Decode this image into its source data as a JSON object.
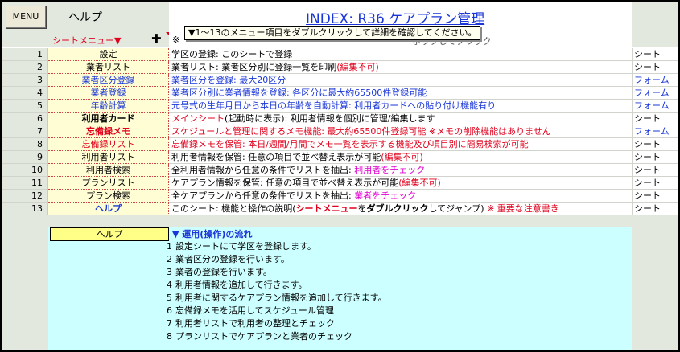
{
  "header": {
    "menu_button": "MENU",
    "help_label": "ヘルプ",
    "title": "INDEX: R36 ケアプラン管理",
    "sheet_menu": "シートメニュー▼",
    "tooltip": "▼1〜13のメニュー項目をダブルクリックして詳細を確認してください。",
    "note_prefix": "※",
    "note_suffix": "ホックしてクリック"
  },
  "menu_rows": [
    {
      "num": "1",
      "name": "設定",
      "desc": [
        {
          "t": "学区の登録: このシートで登録",
          "c": ""
        }
      ],
      "type": "シート"
    },
    {
      "num": "2",
      "name": "業者リスト",
      "desc": [
        {
          "t": "業者リスト: 業者区分別に登録一覧を印刷",
          "c": ""
        },
        {
          "t": "(編集不可)",
          "c": "red"
        }
      ],
      "type": "シート"
    },
    {
      "num": "3",
      "name": "業者区分登録",
      "nameClass": "blue",
      "desc": [
        {
          "t": "業者区分を登録: 最大20区分",
          "c": "blue"
        }
      ],
      "type": "フォーム",
      "typeClass": "blue"
    },
    {
      "num": "4",
      "name": "業者登録",
      "nameClass": "blue",
      "desc": [
        {
          "t": "業者区分別に業者情報を登録: 各区分に最大約65500件登録可能",
          "c": "blue"
        }
      ],
      "type": "フォーム",
      "typeClass": "blue"
    },
    {
      "num": "5",
      "name": "年齢計算",
      "nameClass": "blue",
      "desc": [
        {
          "t": "元号式の生年月日から本日の年齢を自動計算: 利用者カードへの貼り付け機能有り",
          "c": "blue"
        }
      ],
      "type": "フォーム",
      "typeClass": "blue"
    },
    {
      "num": "6",
      "name": "利用者カード",
      "nameClass": "bold",
      "desc": [
        {
          "t": "メインシート",
          "c": "red"
        },
        {
          "t": "(起動時に表示): 利用者情報を個別に管理/編集します",
          "c": ""
        }
      ],
      "type": "シート"
    },
    {
      "num": "7",
      "name": "忘備録メモ",
      "nameClass": "red bold",
      "desc": [
        {
          "t": "スケジュールと管理に関するメモ機能: 最大約65500件登録可能 ※メモの削除機能はありません",
          "c": "red"
        }
      ],
      "type": "フォーム",
      "typeClass": "blue"
    },
    {
      "num": "8",
      "name": "忘備録リスト",
      "nameClass": "red",
      "desc": [
        {
          "t": "忘備録メモを保管: 本日/週間/月間でメモ一覧を表示する機能及び項目別に簡易検索が可能",
          "c": "red"
        }
      ],
      "type": "シート"
    },
    {
      "num": "9",
      "name": "利用者リスト",
      "desc": [
        {
          "t": "利用者情報を保管: 任意の項目で並べ替え表示が可能",
          "c": ""
        },
        {
          "t": "(編集不可)",
          "c": "red"
        }
      ],
      "type": "シート"
    },
    {
      "num": "10",
      "name": "利用者検索",
      "desc": [
        {
          "t": "全利用者情報から任意の条件でリストを抽出: ",
          "c": ""
        },
        {
          "t": "利用者をチェック",
          "c": "mag"
        }
      ],
      "type": "シート"
    },
    {
      "num": "11",
      "name": "プランリスト",
      "desc": [
        {
          "t": "ケアプラン情報を保管: 任意の項目で並べ替え表示が可能",
          "c": ""
        },
        {
          "t": "(編集不可)",
          "c": "red"
        }
      ],
      "type": "シート"
    },
    {
      "num": "12",
      "name": "プラン検索",
      "desc": [
        {
          "t": "全ケアプランから任意の条件でリストを抽出: ",
          "c": ""
        },
        {
          "t": "業者をチェック",
          "c": "mag"
        }
      ],
      "type": "シート"
    },
    {
      "num": "13",
      "name": "ヘルプ",
      "nameClass": "blue bold",
      "desc": [
        {
          "t": "このシート: 機能と操作の説明(",
          "c": ""
        },
        {
          "t": "シートメニュー",
          "c": "red bold"
        },
        {
          "t": "を",
          "c": ""
        },
        {
          "t": "ダブルクリック",
          "c": "bold"
        },
        {
          "t": "してジャンプ) ",
          "c": ""
        },
        {
          "t": "※ 重要な注意書き",
          "c": "red"
        }
      ],
      "type": "シート"
    }
  ],
  "help_section": {
    "label": "ヘルプ",
    "heading": "▼ 運用(操作)の流れ",
    "steps": [
      {
        "n": "1",
        "t": "設定シートにて学区を登録します。"
      },
      {
        "n": "2",
        "t": "業者区分の登録を行います。"
      },
      {
        "n": "3",
        "t": "業者の登録を行います。"
      },
      {
        "n": "4",
        "t": "利用者情報を追加して行きます。"
      },
      {
        "n": "5",
        "t": "利用者に関するケアプラン情報を追加して行きます。"
      },
      {
        "n": "6",
        "t": "忘備録メモを活用してスケジュール管理"
      },
      {
        "n": "7",
        "t": "利用者リストで利用者の整理とチェック"
      },
      {
        "n": "8",
        "t": "プランリストでケアプランと業者のチェック"
      }
    ]
  }
}
